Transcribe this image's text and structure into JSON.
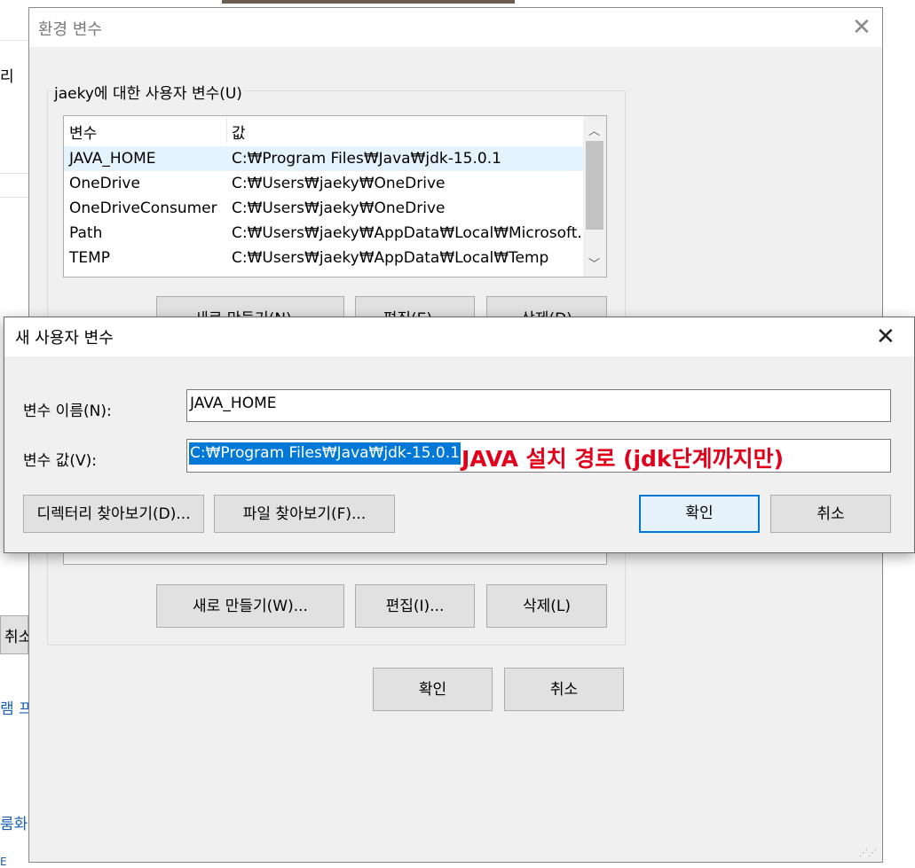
{
  "background": {
    "texts": [
      "리",
      "취소",
      "램 프",
      "룸화",
      "E"
    ]
  },
  "env_dialog": {
    "title": "환경 변수",
    "user_vars_group": "jaeky에 대한 사용자 변수(U)",
    "columns": [
      "변수",
      "값"
    ],
    "rows": [
      {
        "name": "JAVA_HOME",
        "value": "C:₩Program Files₩Java₩jdk-15.0.1"
      },
      {
        "name": "OneDrive",
        "value": "C:₩Users₩jaeky₩OneDrive"
      },
      {
        "name": "OneDriveConsumer",
        "value": "C:₩Users₩jaeky₩OneDrive"
      },
      {
        "name": "Path",
        "value": "C:₩Users₩jaeky₩AppData₩Local₩Microsoft..."
      },
      {
        "name": "TEMP",
        "value": "C:₩Users₩jaeky₩AppData₩Local₩Temp"
      }
    ],
    "user_buttons": [
      "새로 만들기(N)...",
      "편집(E)...",
      "삭제(D)"
    ],
    "system_buttons": [
      "새로 만들기(W)...",
      "편집(I)...",
      "삭제(L)"
    ],
    "ok": "확인",
    "cancel": "취소"
  },
  "new_var_dialog": {
    "title": "새 사용자 변수",
    "name_label": "변수 이름(N):",
    "name_value": "JAVA_HOME",
    "value_label": "변수 값(V):",
    "value_value": "C:₩Program Files₩Java₩jdk-15.0.1",
    "annotation": "JAVA 설치 경로 (jdk단계까지만)",
    "browse_dir": "디렉터리 찾아보기(D)...",
    "browse_file": "파일 찾아보기(F)...",
    "ok": "확인",
    "cancel": "취소"
  },
  "icons": {
    "close": "close-icon",
    "scroll_up": "chevron-up-icon",
    "scroll_down": "chevron-down-icon",
    "resize": "resize-grip-icon"
  },
  "colors": {
    "accent": "#0078d7",
    "annotation": "#e0001b",
    "selection": "#e5f3ff"
  }
}
